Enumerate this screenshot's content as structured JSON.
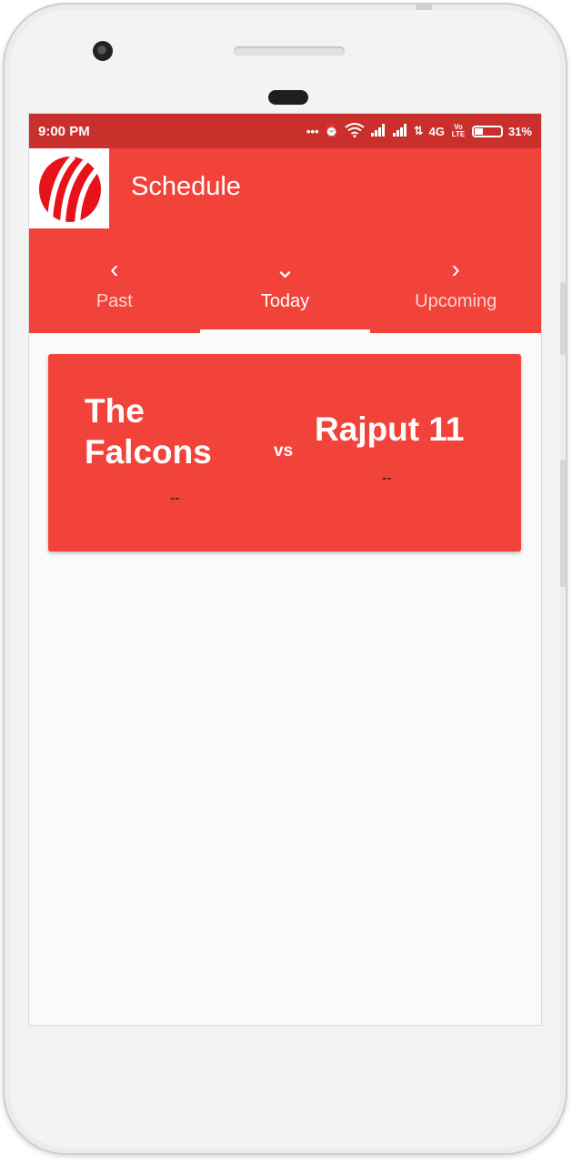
{
  "status_bar": {
    "time": "9:00 PM",
    "icons": [
      "more-dots-icon",
      "alarm-icon",
      "wifi-icon",
      "signal-icon",
      "signal-icon",
      "data-arrows-icon",
      "battery-icon"
    ],
    "network": "4G",
    "volte": "Vo LTE",
    "battery_percent": "31%"
  },
  "app_bar": {
    "title": "Schedule",
    "logo_icon": "cricket-ball-logo"
  },
  "tabs": [
    {
      "label": "Past",
      "icon": "chevron-left-icon",
      "glyph": "‹",
      "active": false
    },
    {
      "label": "Today",
      "icon": "chevron-down-icon",
      "glyph": "⌄",
      "active": true
    },
    {
      "label": "Upcoming",
      "icon": "chevron-right-icon",
      "glyph": "›",
      "active": false
    }
  ],
  "matches": [
    {
      "team_a": "The Falcons",
      "team_a_score": "--",
      "vs": "vs",
      "team_b": "Rajput 11",
      "team_b_score": "--"
    }
  ],
  "colors": {
    "primary": "#f2433a",
    "status_bar": "#c9302c",
    "background": "#fafafa"
  }
}
